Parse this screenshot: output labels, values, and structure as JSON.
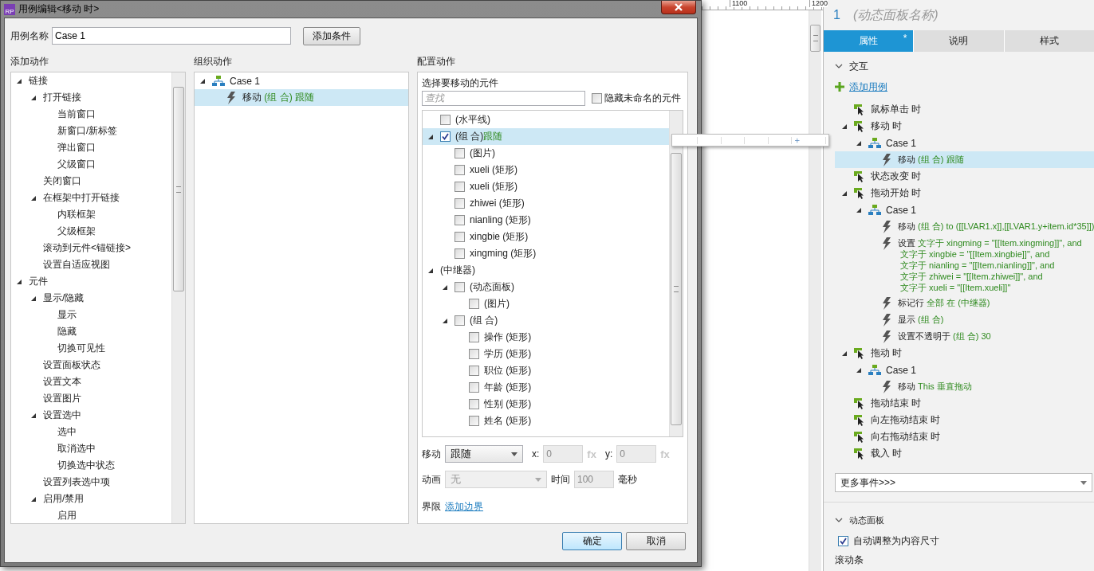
{
  "dialog": {
    "app_logo": "RP",
    "title": "用例编辑<移动 时>",
    "case_name_label": "用例名称",
    "case_name": "Case 1",
    "add_condition_button": "添加条件",
    "add_actions": {
      "heading": "添加动作",
      "tree": [
        {
          "label": "链接",
          "expanded": true,
          "children": [
            {
              "label": "打开链接",
              "expanded": true,
              "children": [
                {
                  "label": "当前窗口"
                },
                {
                  "label": "新窗口/新标签"
                },
                {
                  "label": "弹出窗口"
                },
                {
                  "label": "父级窗口"
                }
              ]
            },
            {
              "label": "关闭窗口"
            },
            {
              "label": "在框架中打开链接",
              "expanded": true,
              "children": [
                {
                  "label": "内联框架"
                },
                {
                  "label": "父级框架"
                }
              ]
            },
            {
              "label": "滚动到元件<锚链接>"
            },
            {
              "label": "设置自适应视图"
            }
          ]
        },
        {
          "label": "元件",
          "expanded": true,
          "children": [
            {
              "label": "显示/隐藏",
              "expanded": true,
              "children": [
                {
                  "label": "显示"
                },
                {
                  "label": "隐藏"
                },
                {
                  "label": "切换可见性"
                }
              ]
            },
            {
              "label": "设置面板状态"
            },
            {
              "label": "设置文本"
            },
            {
              "label": "设置图片"
            },
            {
              "label": "设置选中",
              "expanded": true,
              "children": [
                {
                  "label": "选中"
                },
                {
                  "label": "取消选中"
                },
                {
                  "label": "切换选中状态"
                }
              ]
            },
            {
              "label": "设置列表选中项"
            },
            {
              "label": "启用/禁用",
              "expanded": true,
              "children": [
                {
                  "label": "启用"
                }
              ]
            }
          ]
        }
      ]
    },
    "organize_actions": {
      "heading": "组织动作",
      "cases": [
        {
          "label": "Case 1",
          "expanded": true,
          "actions": [
            {
              "verb": "移动",
              "detail": "(组 合) 跟随",
              "selected": true
            }
          ]
        }
      ]
    },
    "configure": {
      "heading": "配置动作",
      "prompt": "选择要移动的元件",
      "search_placeholder": "查找",
      "hide_unnamed": {
        "label": "隐藏未命名的元件",
        "checked": false
      },
      "widgets": [
        {
          "kind": "checkbox",
          "label": "(水平线)",
          "checked": false,
          "selected": false
        },
        {
          "kind": "checkbox",
          "label": "(组 合)",
          "note": "跟随",
          "checked": true,
          "selected": true,
          "expanded": true,
          "children": [
            {
              "kind": "checkbox",
              "label": "(图片)",
              "checked": false,
              "selected": false
            },
            {
              "kind": "checkbox",
              "label": "xueli (矩形)",
              "checked": false,
              "selected": false
            },
            {
              "kind": "checkbox",
              "label": "xueli (矩形)",
              "checked": false,
              "selected": false
            },
            {
              "kind": "checkbox",
              "label": "zhiwei (矩形)",
              "checked": false,
              "selected": false
            },
            {
              "kind": "checkbox",
              "label": "nianling (矩形)",
              "checked": false,
              "selected": false
            },
            {
              "kind": "checkbox",
              "label": "xingbie (矩形)",
              "checked": false,
              "selected": false
            },
            {
              "kind": "checkbox",
              "label": "xingming (矩形)",
              "checked": false,
              "selected": false
            }
          ]
        },
        {
          "kind": "plain",
          "label": "(中继器)",
          "selected": false,
          "expanded": true,
          "children": [
            {
              "kind": "checkbox",
              "label": "(动态面板)",
              "checked": false,
              "selected": false,
              "expanded": true,
              "children": [
                {
                  "kind": "checkbox",
                  "label": "(图片)",
                  "checked": false,
                  "selected": false
                }
              ]
            },
            {
              "kind": "checkbox",
              "label": "(组 合)",
              "checked": false,
              "selected": false,
              "expanded": true,
              "children": [
                {
                  "kind": "checkbox",
                  "label": "操作 (矩形)",
                  "checked": false,
                  "selected": false
                },
                {
                  "kind": "checkbox",
                  "label": "学历 (矩形)",
                  "checked": false,
                  "selected": false
                },
                {
                  "kind": "checkbox",
                  "label": "职位 (矩形)",
                  "checked": false,
                  "selected": false
                },
                {
                  "kind": "checkbox",
                  "label": "年龄 (矩形)",
                  "checked": false,
                  "selected": false
                },
                {
                  "kind": "checkbox",
                  "label": "性别 (矩形)",
                  "checked": false,
                  "selected": false
                },
                {
                  "kind": "checkbox",
                  "label": "姓名 (矩形)",
                  "checked": false,
                  "selected": false
                }
              ]
            }
          ]
        }
      ],
      "move_label": "移动",
      "move_mode": "跟随",
      "x_label": "x:",
      "x_field": {
        "value": "0",
        "disabled": true
      },
      "x_fx": "fx",
      "y_label": "y:",
      "y_field": {
        "value": "0",
        "disabled": true
      },
      "y_fx": "fx",
      "animate_label": "动画",
      "animate_field": {
        "value": "无",
        "disabled": true
      },
      "time_label": "时间",
      "time_field": {
        "value": "100",
        "disabled": true
      },
      "ms_label": "毫秒",
      "bounds_label": "界限",
      "add_bounds_link": "添加边界"
    },
    "ok_button": "确定",
    "cancel_button": "取消"
  },
  "canvas": {
    "ruler_labels": [
      "1100",
      "1200"
    ]
  },
  "inspector": {
    "number": "1",
    "name_placeholder": "(动态面板名称)",
    "tabs": [
      {
        "label": "属性",
        "mark": "*",
        "selected": true
      },
      {
        "label": "说明",
        "selected": false
      },
      {
        "label": "样式",
        "selected": false
      }
    ],
    "interaction": {
      "heading": "交互",
      "expanded": true,
      "add_case_link": "添加用例",
      "events": [
        {
          "label": "鼠标单击 时"
        },
        {
          "label": "移动 时",
          "expanded": true,
          "cases": [
            {
              "label": "Case 1",
              "expanded": true,
              "actions": [
                {
                  "verb": "移动",
                  "lines": [
                    "(组 合) 跟随"
                  ],
                  "selected": true
                }
              ]
            }
          ]
        },
        {
          "label": "状态改变 时"
        },
        {
          "label": "拖动开始 时",
          "expanded": true,
          "cases": [
            {
              "label": "Case 1",
              "expanded": true,
              "actions": [
                {
                  "verb": "移动",
                  "lines": [
                    "(组 合) to ([[LVAR1.x]],[[LVAR1.y+item.id*35]])"
                  ],
                  "selected": false
                },
                {
                  "verb": "设置",
                  "lines": [
                    "文字于 xingming = \"[[Item.xingming]]\", and",
                    "文字于 xingbie = \"[[Item.xingbie]]\", and",
                    "文字于 nianling = \"[[Item.nianling]]\", and",
                    "文字于 zhiwei = \"[[Item.zhiwei]]\", and",
                    "文字于 xueli = \"[[Item.xueli]]\""
                  ],
                  "selected": false
                },
                {
                  "verb": "标记行",
                  "lines": [
                    "全部 在 (中继器)"
                  ],
                  "selected": false
                },
                {
                  "verb": "显示",
                  "lines": [
                    "(组 合)"
                  ],
                  "selected": false
                },
                {
                  "verb": "设置不透明于",
                  "lines": [
                    "(组 合) 30"
                  ],
                  "selected": false
                }
              ]
            }
          ]
        },
        {
          "label": "拖动 时",
          "expanded": true,
          "cases": [
            {
              "label": "Case 1",
              "expanded": true,
              "actions": [
                {
                  "verb": "移动",
                  "lines": [
                    "This 垂直拖动"
                  ],
                  "selected": false
                }
              ]
            }
          ]
        },
        {
          "label": "拖动结束 时"
        },
        {
          "label": "向左拖动结束 时"
        },
        {
          "label": "向右拖动结束 时"
        },
        {
          "label": "载入 时"
        }
      ]
    },
    "more_events": "更多事件>>>",
    "panel_section": {
      "heading": "动态面板",
      "expanded": true,
      "auto_fit": {
        "label": "自动调整为内容尺寸",
        "checked": true
      }
    },
    "scrollbar_heading": "滚动条"
  }
}
